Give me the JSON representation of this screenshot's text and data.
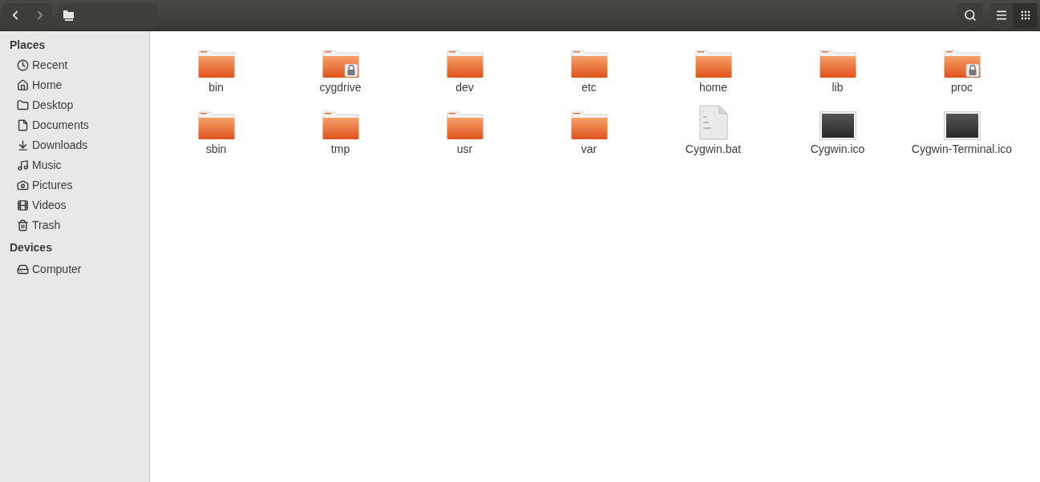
{
  "toolbar": {
    "back": {
      "disabled": false
    },
    "forward": {
      "disabled": true
    }
  },
  "sidebar": {
    "sections": [
      {
        "title": "Places",
        "items": [
          {
            "label": "Recent"
          },
          {
            "label": "Home"
          },
          {
            "label": "Desktop"
          },
          {
            "label": "Documents"
          },
          {
            "label": "Downloads"
          },
          {
            "label": "Music"
          },
          {
            "label": "Pictures"
          },
          {
            "label": "Videos"
          },
          {
            "label": "Trash"
          }
        ]
      },
      {
        "title": "Devices",
        "items": [
          {
            "label": "Computer"
          }
        ]
      }
    ]
  },
  "files": [
    {
      "name": "bin",
      "kind": "folder"
    },
    {
      "name": "cygdrive",
      "kind": "locked-folder"
    },
    {
      "name": "dev",
      "kind": "folder"
    },
    {
      "name": "etc",
      "kind": "folder"
    },
    {
      "name": "home",
      "kind": "folder"
    },
    {
      "name": "lib",
      "kind": "folder"
    },
    {
      "name": "proc",
      "kind": "locked-folder"
    },
    {
      "name": "sbin",
      "kind": "folder"
    },
    {
      "name": "tmp",
      "kind": "folder"
    },
    {
      "name": "usr",
      "kind": "folder"
    },
    {
      "name": "var",
      "kind": "folder"
    },
    {
      "name": "Cygwin.bat",
      "kind": "binary"
    },
    {
      "name": "Cygwin.ico",
      "kind": "image"
    },
    {
      "name": "Cygwin-Terminal.ico",
      "kind": "image"
    }
  ]
}
